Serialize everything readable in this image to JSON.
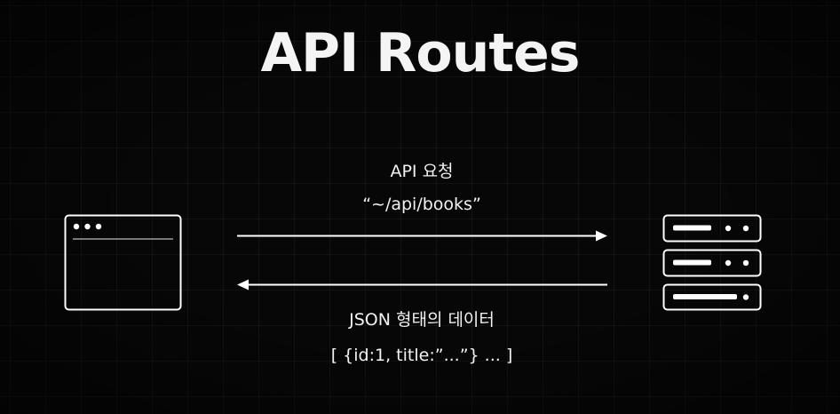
{
  "title": "API Routes",
  "request": {
    "label": "API 요청",
    "route": "“~/api/books”"
  },
  "response": {
    "label": "JSON 형태의 데이터",
    "sample": "[ {id:1, title:”...”} ... ]"
  },
  "colors": {
    "background": "#070707",
    "foreground": "#ffffff",
    "grid": "#1a1a1a"
  },
  "icons": {
    "client": "browser-window-icon",
    "server": "server-stack-icon"
  }
}
